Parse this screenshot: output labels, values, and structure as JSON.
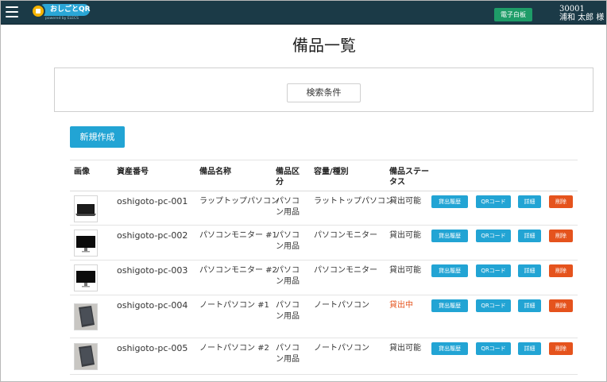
{
  "header": {
    "logo_text": "おしごとQR",
    "logo_sub": "powered by ELECS",
    "whiteboard_label": "電子白板",
    "user_id": "30001",
    "user_name": "浦和 太郎 様"
  },
  "page": {
    "title": "備品一覧",
    "search_label": "検索条件",
    "new_label": "新規作成"
  },
  "table": {
    "headers": {
      "image": "画像",
      "asset_no": "資産番号",
      "name": "備品名称",
      "category": "備品区分",
      "capacity": "容量/種別",
      "status": "備品ステータス"
    },
    "actions": {
      "history": "貸出履歴",
      "qr": "QRコード",
      "detail": "詳細",
      "delete": "削除"
    },
    "rows": [
      {
        "asset_no": "oshigoto-pc-001",
        "name": "ラップトップパソコン",
        "category": "パソコン用品",
        "capacity": "ラットトップパソコン",
        "status": "貸出可能",
        "status_color": "#333333",
        "icon": "laptop-icon"
      },
      {
        "asset_no": "oshigoto-pc-002",
        "name": "パソコンモニター #1",
        "category": "パソコン用品",
        "capacity": "パソコンモニター",
        "status": "貸出可能",
        "status_color": "#333333",
        "icon": "monitor-icon"
      },
      {
        "asset_no": "oshigoto-pc-003",
        "name": "パソコンモニター #2",
        "category": "パソコン用品",
        "capacity": "パソコンモニター",
        "status": "貸出可能",
        "status_color": "#333333",
        "icon": "monitor-icon"
      },
      {
        "asset_no": "oshigoto-pc-004",
        "name": "ノートパソコン #1",
        "category": "パソコン用品",
        "capacity": "ノートパソコン",
        "status": "貸出中",
        "status_color": "#e5531d",
        "icon": "notebook-icon"
      },
      {
        "asset_no": "oshigoto-pc-005",
        "name": "ノートパソコン #2",
        "category": "パソコン用品",
        "capacity": "ノートパソコン",
        "status": "貸出可能",
        "status_color": "#333333",
        "icon": "notebook-icon"
      }
    ]
  },
  "colors": {
    "topbar": "#1b3a47",
    "accent_blue": "#22a4d4",
    "danger": "#e5531d",
    "whiteboard": "#1e9c68"
  }
}
